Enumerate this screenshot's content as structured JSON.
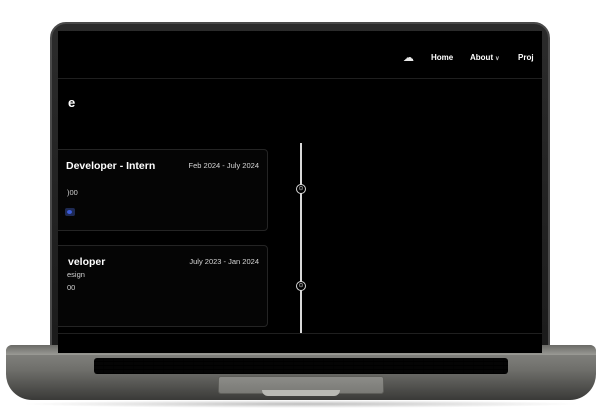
{
  "nav": {
    "icon": "weather-icon",
    "home_label": "Home",
    "about_label": "About",
    "projects_label": "Proj"
  },
  "section": {
    "title": "e"
  },
  "experience": [
    {
      "role": "Developer - Intern",
      "dates": "Feb 2024 - July 2024",
      "lines": [
        ")00"
      ]
    },
    {
      "role": "veloper",
      "dates": "July 2023 - Jan 2024",
      "lines": [
        "esign",
        "00"
      ]
    }
  ],
  "colors": {
    "screen_bg": "#000000",
    "text": "#ffffff",
    "timeline": "#d8d8d8",
    "tag": "#3b5bd9"
  }
}
